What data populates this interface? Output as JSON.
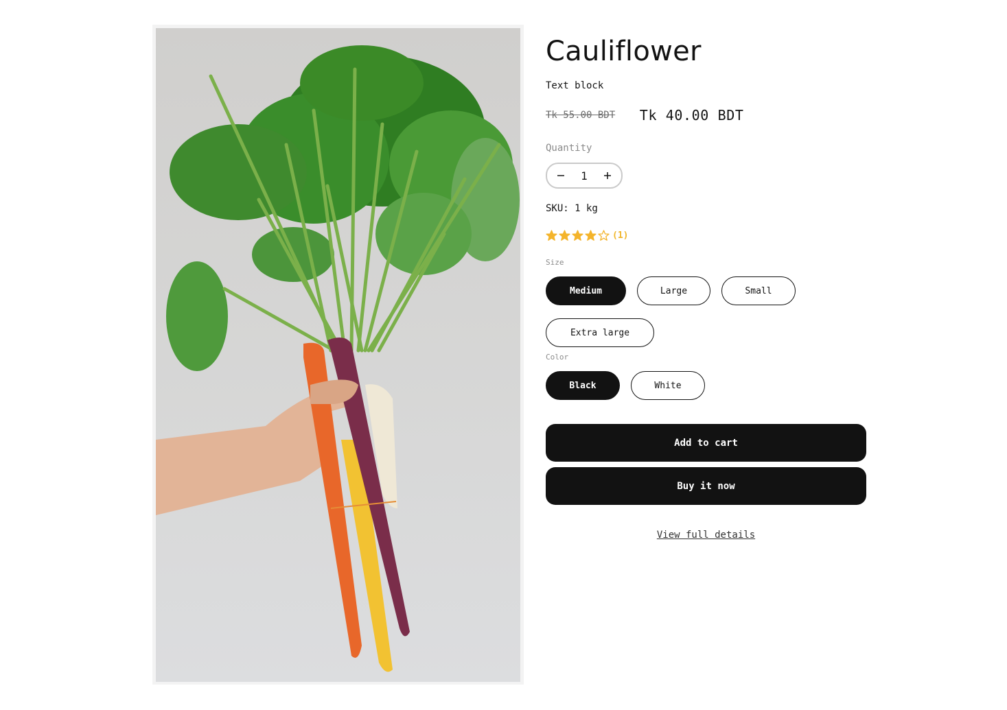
{
  "product": {
    "title": "Cauliflower",
    "text_block": "Text block",
    "image_alt": "Bunch of carrots held in a hand"
  },
  "price": {
    "compare_at": "Tk 55.00 BDT",
    "sale": "Tk 40.00 BDT"
  },
  "quantity": {
    "label": "Quantity",
    "value": "1",
    "minus_icon": "minus-icon",
    "plus_icon": "plus-icon"
  },
  "sku": "SKU: 1 kg",
  "rating": {
    "value": 4,
    "max": 5,
    "count_label": "(1)",
    "star_color": "#f4b42b"
  },
  "options": {
    "size": {
      "label": "Size",
      "values": [
        "Medium",
        "Large",
        "Small",
        "Extra large"
      ],
      "selected": "Medium"
    },
    "color": {
      "label": "Color",
      "values": [
        "Black",
        "White"
      ],
      "selected": "Black"
    }
  },
  "actions": {
    "add_to_cart": "Add to cart",
    "buy_now": "Buy it now",
    "view_details": "View full details"
  },
  "colors": {
    "button_bg": "#121212",
    "button_text": "#ffffff",
    "muted_text": "#8a8a8a"
  }
}
